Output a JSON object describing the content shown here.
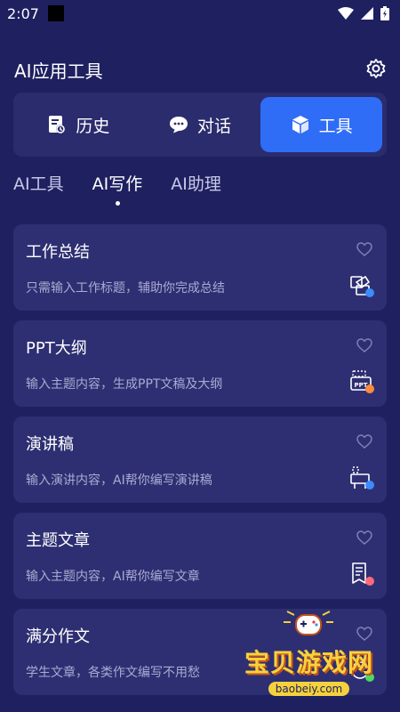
{
  "status_bar": {
    "time": "2:07"
  },
  "header": {
    "title": "AI应用工具"
  },
  "segments": [
    {
      "label": "历史",
      "icon": "history-doc-icon"
    },
    {
      "label": "对话",
      "icon": "chat-bubble-icon"
    },
    {
      "label": "工具",
      "icon": "cube-icon",
      "active": true
    }
  ],
  "subtabs": [
    {
      "label": "AI工具"
    },
    {
      "label": "AI写作",
      "active": true
    },
    {
      "label": "AI助理"
    }
  ],
  "cards": [
    {
      "title": "工作总结",
      "desc": "只需输入工作标题，辅助你完成总结",
      "icon": "summary-doc-icon",
      "badge_color": "#3a8cff"
    },
    {
      "title": "PPT大纲",
      "desc": "输入主题内容，生成PPT文稿及大纲",
      "icon": "ppt-icon",
      "badge_color": "#ff8a3d"
    },
    {
      "title": "演讲稿",
      "desc": "输入演讲内容，AI帮你编写演讲稿",
      "icon": "speech-icon",
      "badge_color": "#3a8cff"
    },
    {
      "title": "主题文章",
      "desc": "输入主题内容，AI帮你编写文章",
      "icon": "article-icon",
      "badge_color": "#ff6a7a"
    },
    {
      "title": "满分作文",
      "desc": "学生文章，各类作文编写不用愁",
      "icon": "essay-icon",
      "badge_color": "#4cd964"
    }
  ],
  "watermark": {
    "text": "宝贝游戏网",
    "url": "baobeiy.com"
  },
  "colors": {
    "background": "#1f2060",
    "card": "#2e2f72",
    "accent": "#2f6df6"
  }
}
